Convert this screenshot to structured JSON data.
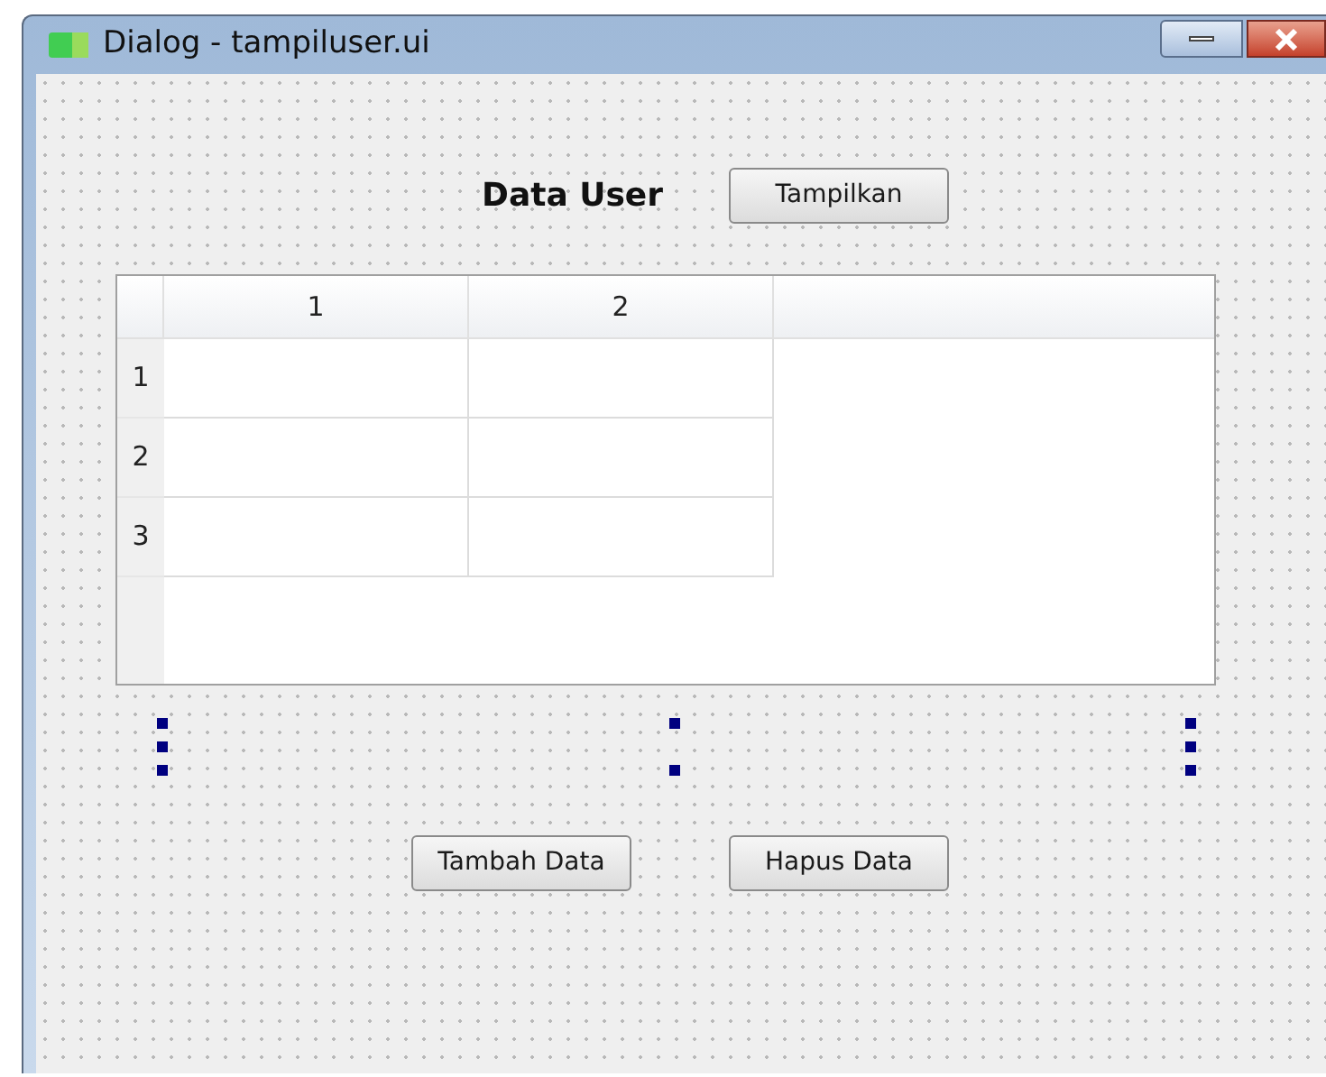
{
  "window": {
    "title": "Dialog - tampiluser.ui"
  },
  "header": {
    "label": "Data User",
    "button": "Tampilkan"
  },
  "table": {
    "columns": [
      "1",
      "2"
    ],
    "rows": [
      {
        "header": "1"
      },
      {
        "header": "2"
      },
      {
        "header": "3"
      }
    ]
  },
  "buttons": [
    "Tambah Data",
    "Hapus Data"
  ]
}
